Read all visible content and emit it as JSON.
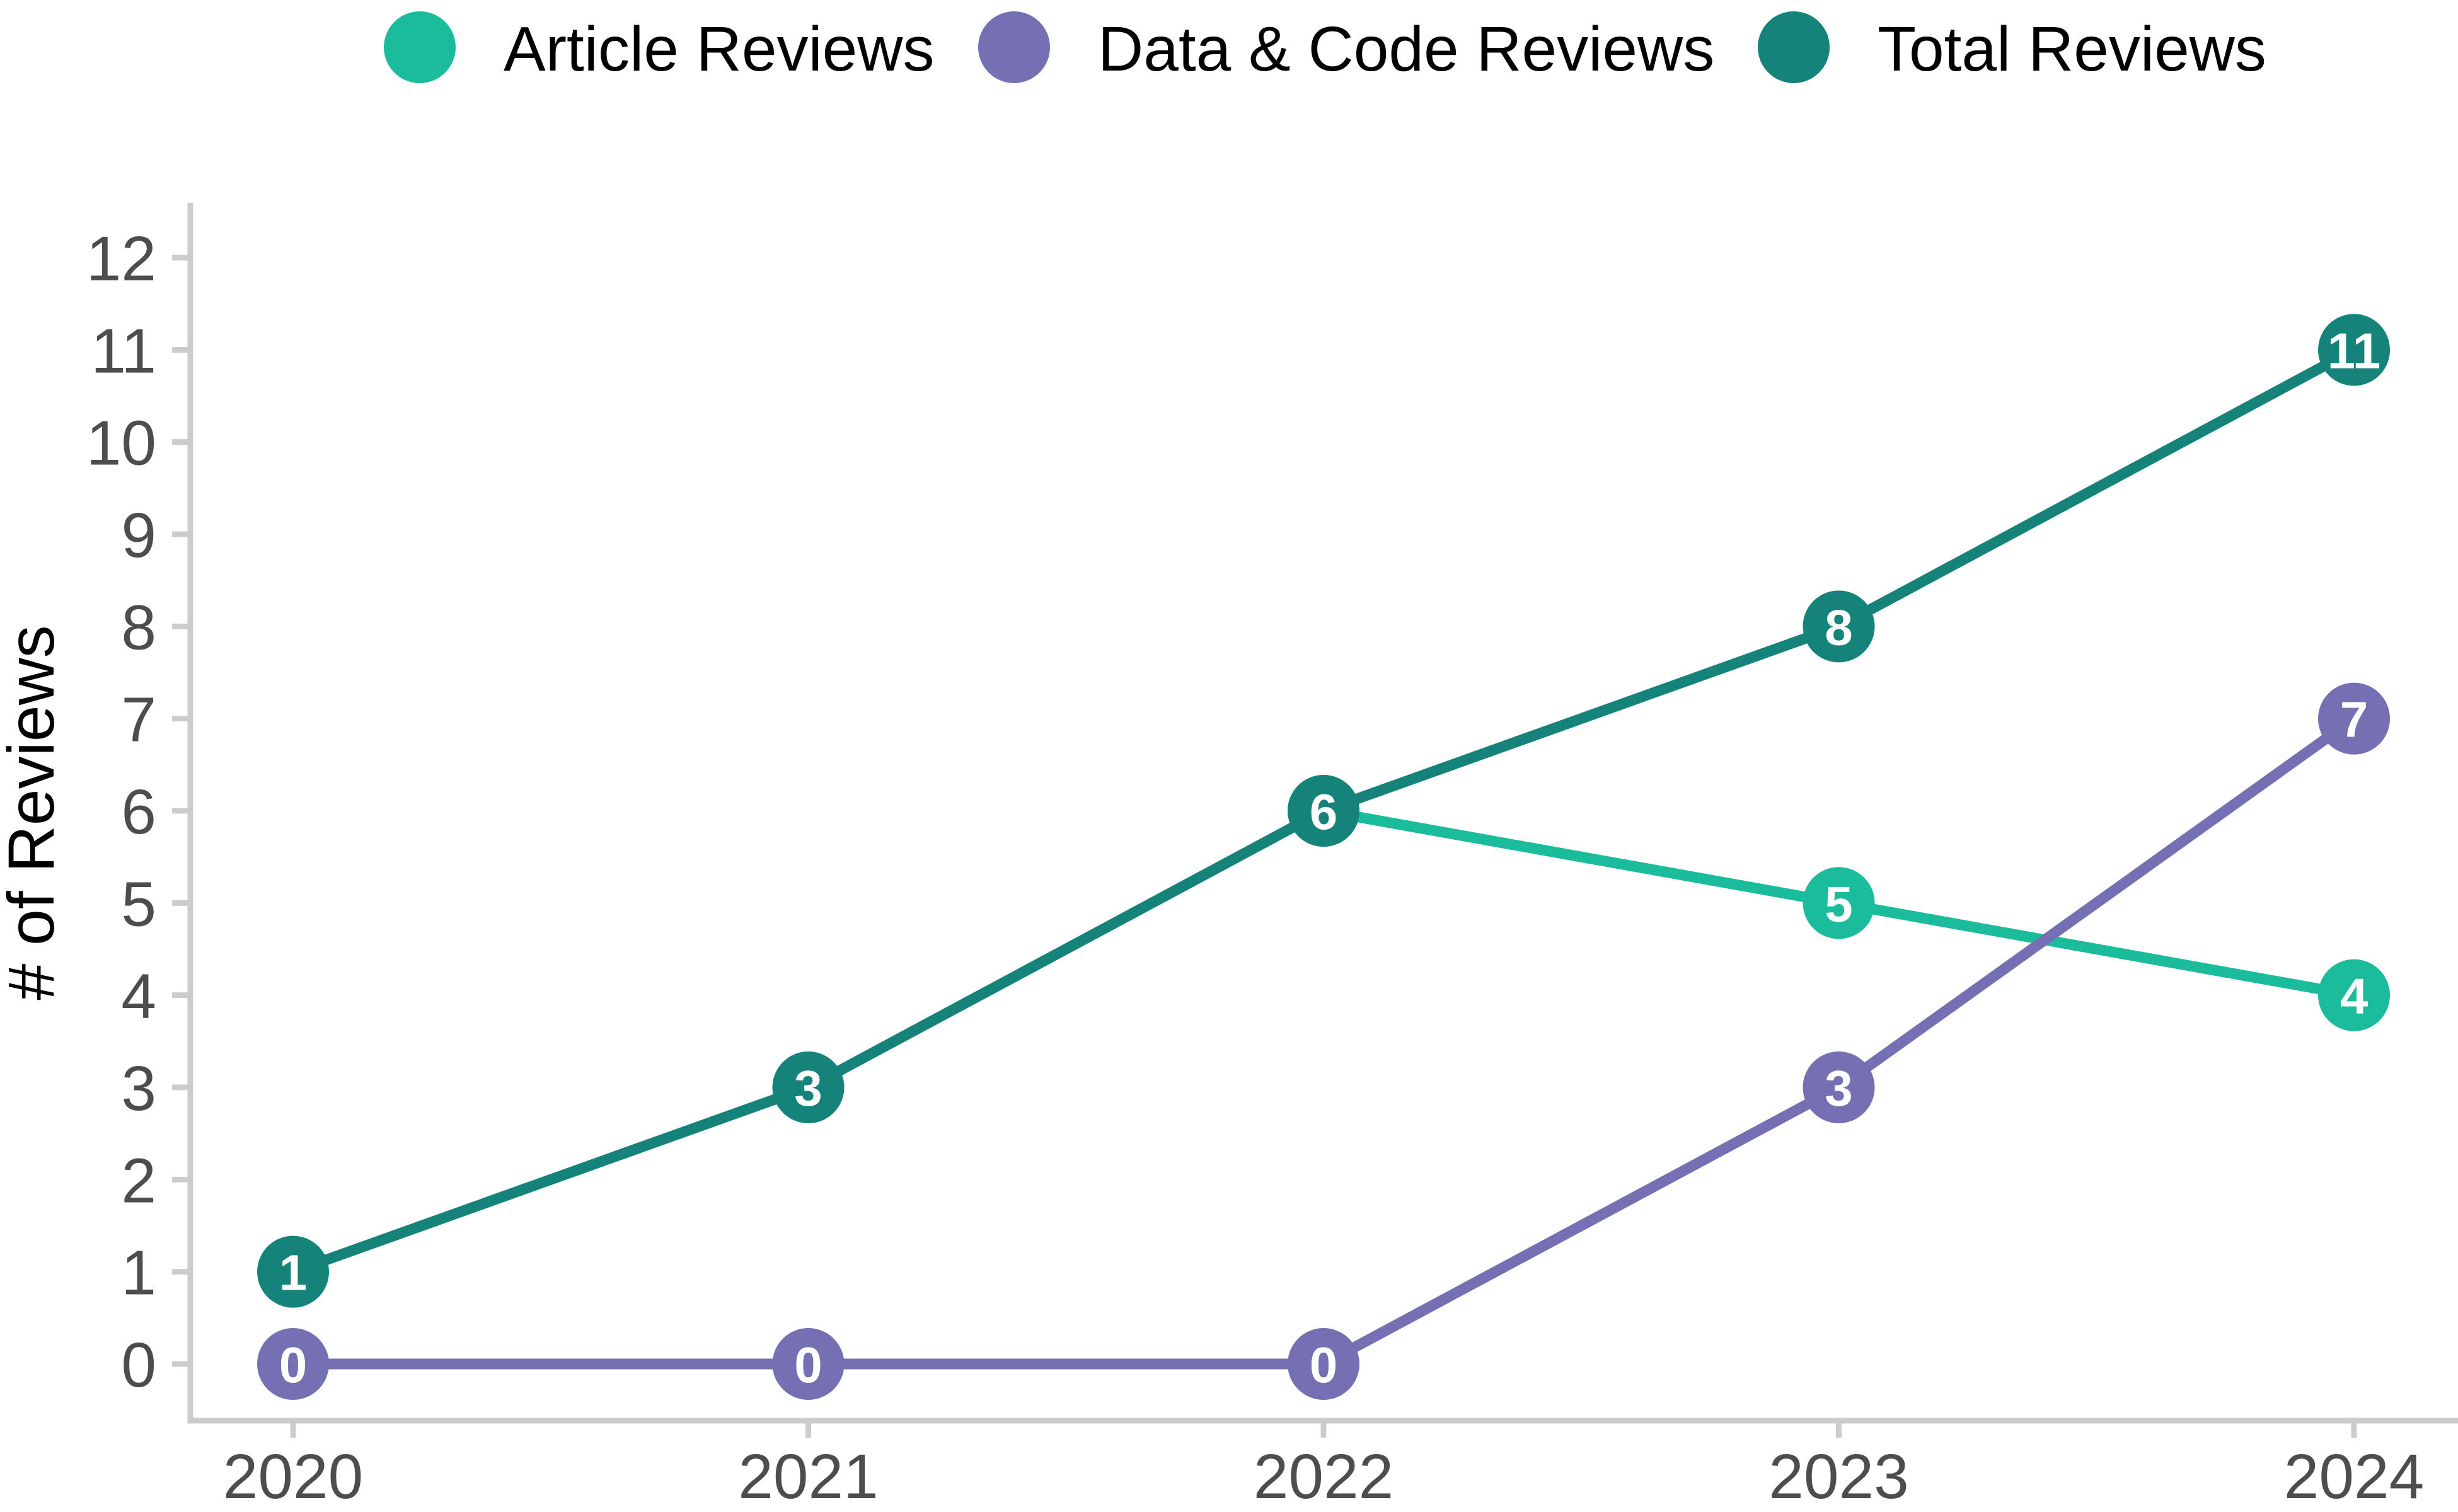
{
  "chart_data": {
    "type": "line",
    "title": "",
    "xlabel": "",
    "ylabel": "# of Reviews",
    "x": [
      2020,
      2021,
      2022,
      2023,
      2024
    ],
    "x_tick_labels": [
      "2020",
      "2021",
      "2022",
      "2023",
      "2024"
    ],
    "y_ticks": [
      0,
      1,
      2,
      3,
      4,
      5,
      6,
      7,
      8,
      9,
      10,
      11,
      12
    ],
    "y_tick_labels": [
      "0",
      "1",
      "2",
      "3",
      "4",
      "5",
      "6",
      "7",
      "8",
      "9",
      "10",
      "11",
      "12"
    ],
    "ylim": [
      0,
      12
    ],
    "grid": false,
    "legend_position": "top",
    "data_labels": true,
    "series": [
      {
        "name": "Article Reviews",
        "color": "#1ABC9C",
        "values": [
          null,
          null,
          6,
          5,
          4
        ],
        "labels": [
          "",
          "",
          "6",
          "5",
          "4"
        ]
      },
      {
        "name": "Data & Code Reviews",
        "color": "#7570B3",
        "values": [
          0,
          0,
          0,
          3,
          7
        ],
        "labels": [
          "0",
          "0",
          "0",
          "3",
          "7"
        ]
      },
      {
        "name": "Total Reviews",
        "color": "#16837A",
        "values": [
          1,
          3,
          6,
          8,
          11
        ],
        "labels": [
          "1",
          "3",
          "6",
          "8",
          "11"
        ]
      }
    ],
    "legend": [
      "Article Reviews",
      "Data & Code Reviews",
      "Total Reviews"
    ]
  }
}
